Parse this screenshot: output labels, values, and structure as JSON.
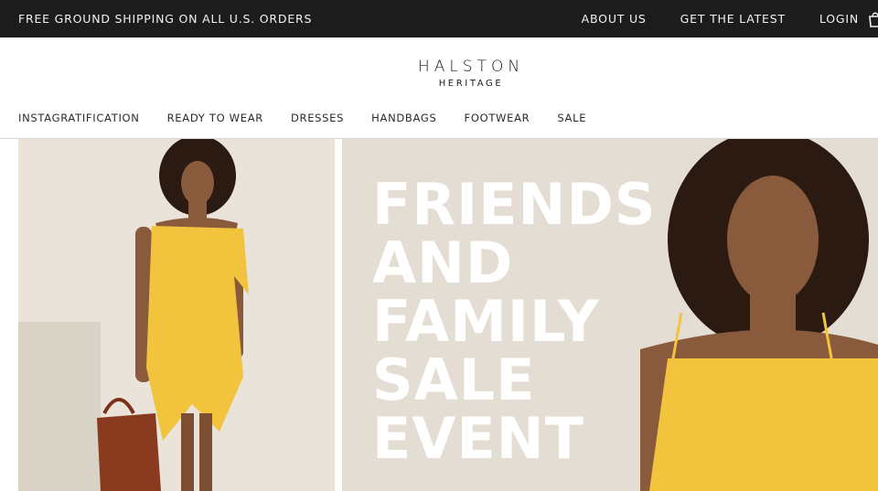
{
  "topbar": {
    "promo": "FREE GROUND SHIPPING ON ALL U.S. ORDERS",
    "links": [
      "ABOUT US",
      "GET THE LATEST",
      "LOGIN"
    ]
  },
  "brand": {
    "name": "HALSTON",
    "sub": "HERITAGE"
  },
  "nav": {
    "items": [
      "INSTAGRATIFICATION",
      "READY TO WEAR",
      "DRESSES",
      "HANDBAGS",
      "FOOTWEAR",
      "SALE"
    ]
  },
  "hero": {
    "lines": [
      "FRIENDS",
      "AND",
      "FAMILY",
      "SALE",
      "EVENT"
    ]
  },
  "colors": {
    "topbar_bg": "#1c1c1c",
    "dress_yellow": "#f2c43d",
    "bag_brown": "#8a3a1e",
    "hero_bg": "#e8e1d8"
  }
}
